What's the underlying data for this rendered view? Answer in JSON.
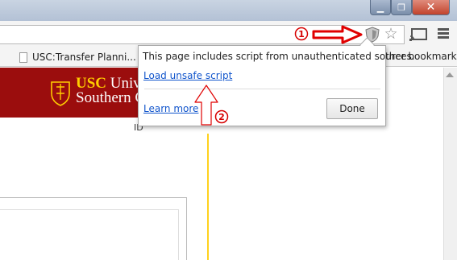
{
  "window": {
    "minimize_glyph": "▁",
    "maximize_glyph": "❐",
    "close_glyph": "✕"
  },
  "toolbar": {
    "shield_icon": "shield-icon",
    "star_icon": "star-icon",
    "star_glyph": "☆",
    "cast_icon": "cast-icon",
    "menu_icon": "menu-icon"
  },
  "bookmarks": {
    "items": [
      {
        "label": "USC:Transfer Planni..."
      }
    ],
    "other_label": "ther bookmarks"
  },
  "page": {
    "logo_line1_usc": "USC",
    "logo_line1_rest": " Unive",
    "logo_line2": "Southern C",
    "cursor_text": "ID"
  },
  "popup": {
    "message": "This page includes script from unauthenticated sources.",
    "load_unsafe_label": "Load unsafe script",
    "learn_more_label": "Learn more",
    "done_label": "Done"
  },
  "annotations": {
    "marker_1": "1",
    "marker_2": "2",
    "arrow_color": "#e00000"
  },
  "colors": {
    "usc_cardinal": "#9b0d0d",
    "usc_gold": "#ffcc00",
    "link_blue": "#1155cc"
  }
}
